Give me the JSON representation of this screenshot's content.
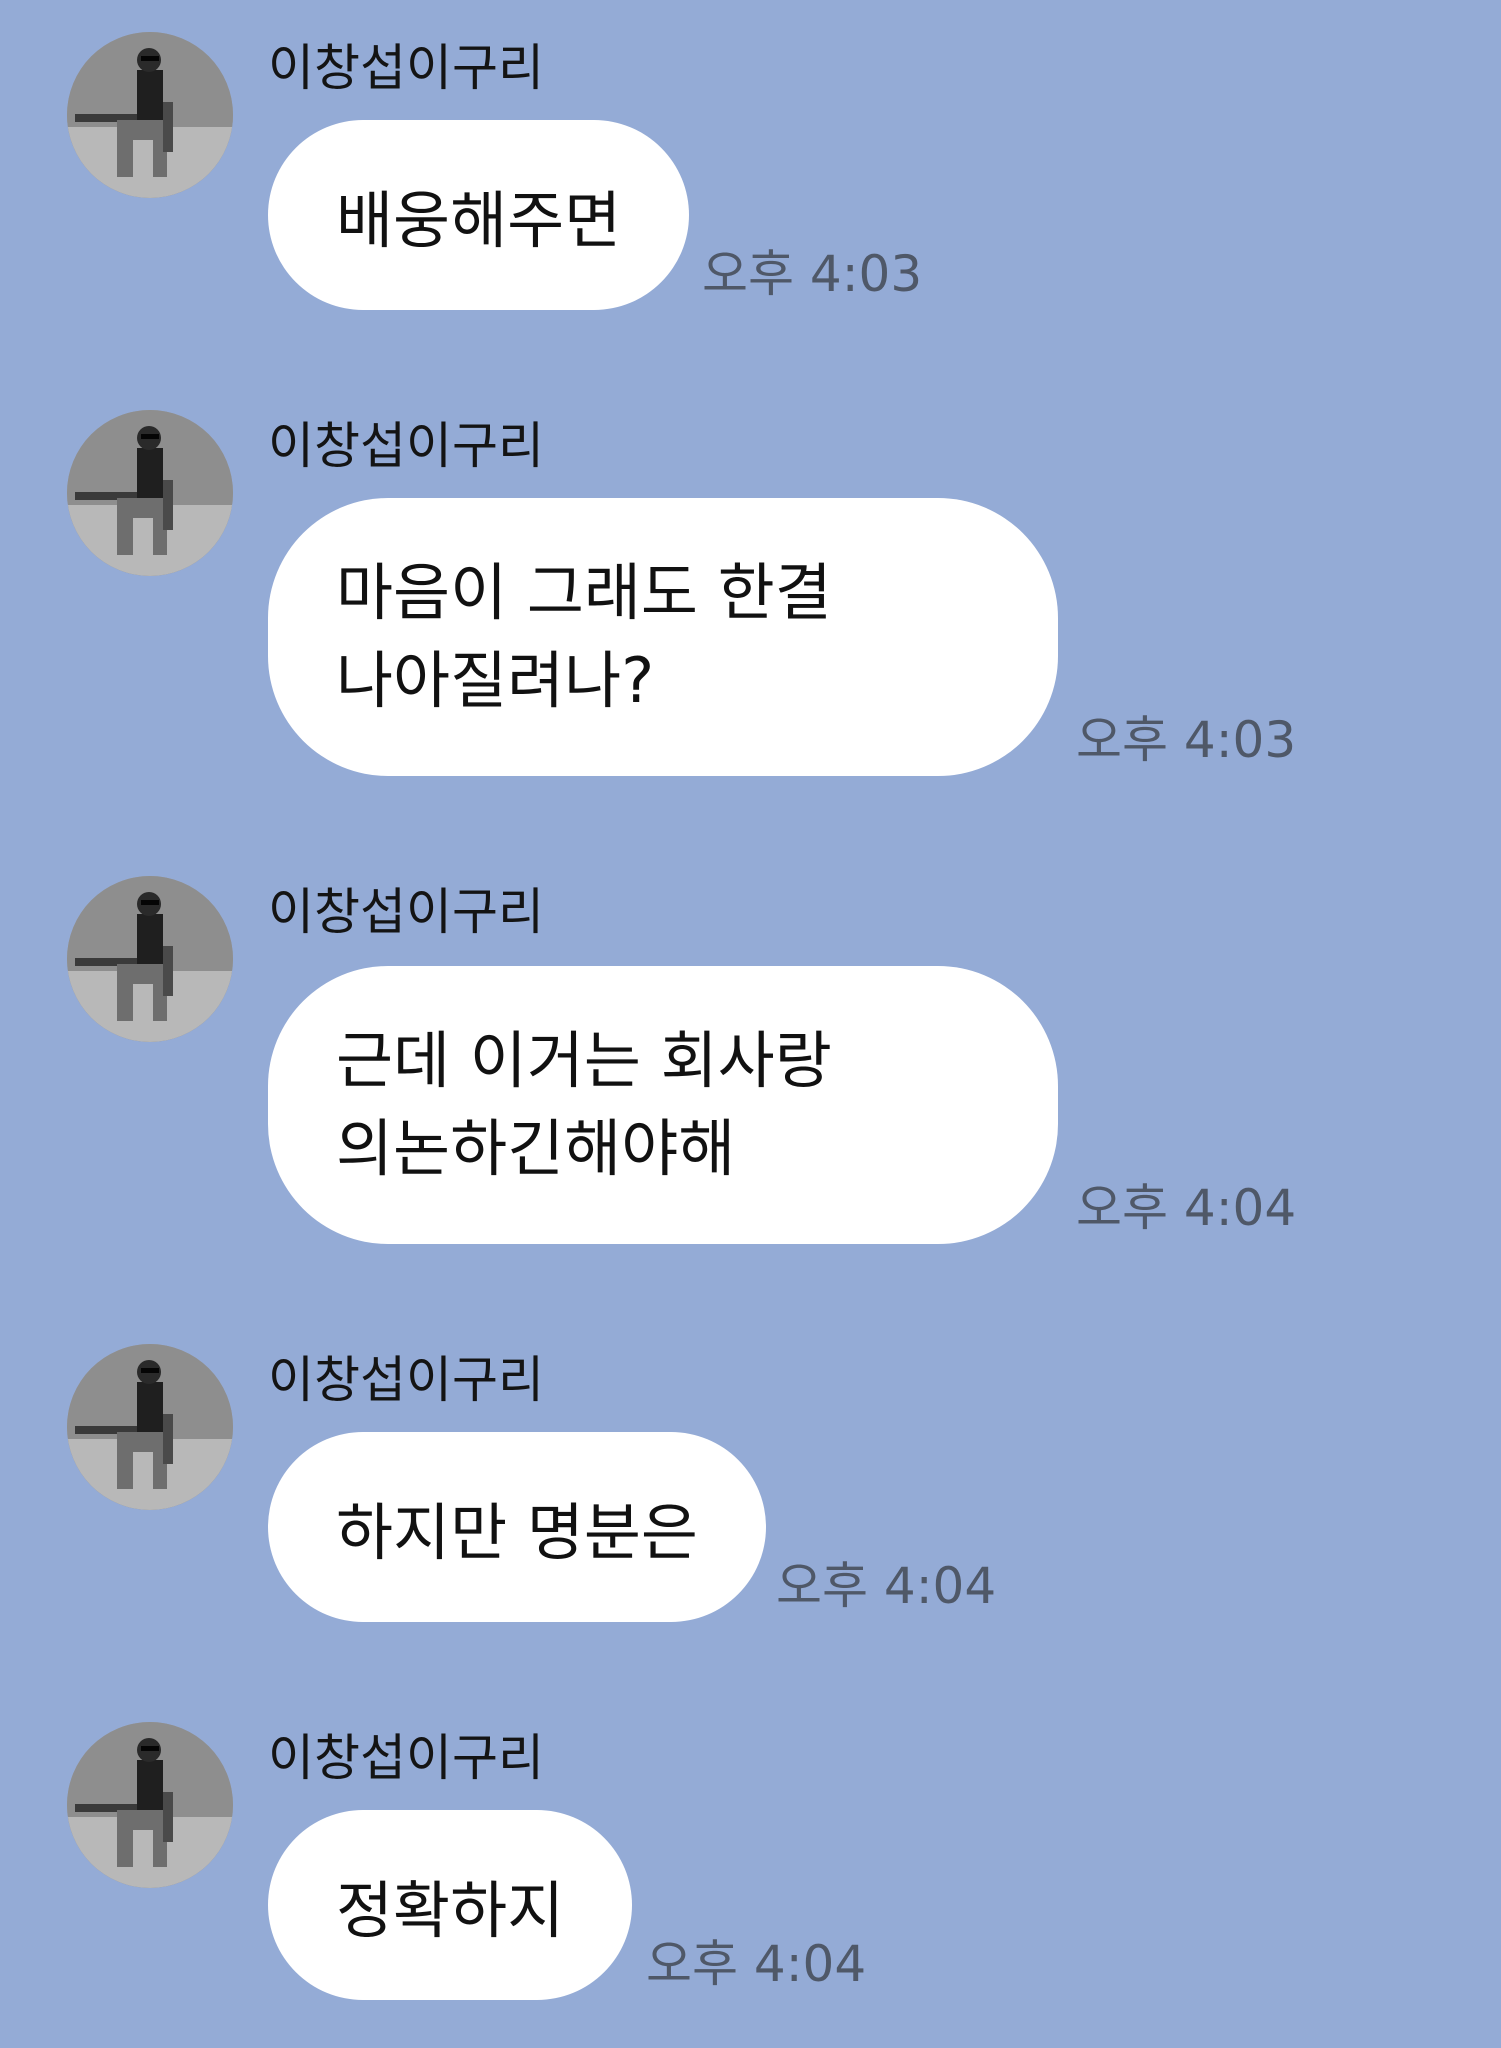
{
  "colors": {
    "background": "#94abd6",
    "bubble": "#ffffff",
    "sender_text": "#141414",
    "time_text": "#4f5868"
  },
  "messages": [
    {
      "sender": "이창섭이구리",
      "avatar_icon": "profile-photo",
      "lines": [
        "배웅해주면"
      ],
      "time": "오후 4:03"
    },
    {
      "sender": "이창섭이구리",
      "avatar_icon": "profile-photo",
      "lines": [
        "마음이 그래도 한결",
        "나아질려나?"
      ],
      "time": "오후 4:03"
    },
    {
      "sender": "이창섭이구리",
      "avatar_icon": "profile-photo",
      "lines": [
        "근데 이거는 회사랑",
        "의논하긴해야해"
      ],
      "time": "오후 4:04"
    },
    {
      "sender": "이창섭이구리",
      "avatar_icon": "profile-photo",
      "lines": [
        "하지만 명분은"
      ],
      "time": "오후 4:04"
    },
    {
      "sender": "이창섭이구리",
      "avatar_icon": "profile-photo",
      "lines": [
        "정확하지"
      ],
      "time": "오후 4:04"
    }
  ]
}
